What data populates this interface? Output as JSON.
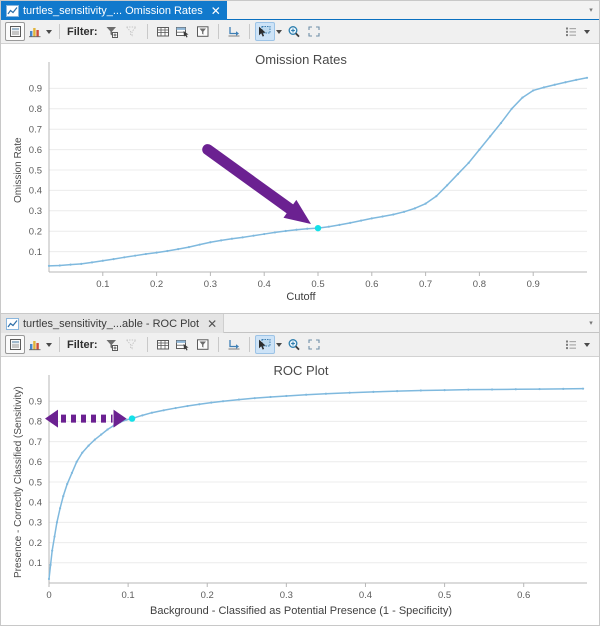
{
  "window": {
    "dropdown_glyph": "▾"
  },
  "panels": [
    {
      "tab": {
        "label": "turtles_sensitivity_... Omission Rates",
        "close": "✕",
        "icon": "chart-line-icon",
        "active": true
      },
      "toolbar": {
        "filter_label": "Filter:",
        "buttons": [
          {
            "name": "table-view-button",
            "icon": "table-view-icon"
          },
          {
            "name": "chart-view-button",
            "icon": "bar-chart-icon",
            "caret": true
          },
          {
            "name": "filter-build-button",
            "icon": "funnel-add-icon"
          },
          {
            "name": "filter-clear-button",
            "icon": "funnel-clear-icon",
            "dim": true
          },
          {
            "name": "show-all-records-button",
            "icon": "grid-icon"
          },
          {
            "name": "show-selected-records-button",
            "icon": "grid-selected-icon"
          },
          {
            "name": "show-extent-records-button",
            "icon": "funnel-extent-icon"
          },
          {
            "name": "switch-selection-button",
            "icon": "switch-selection-icon"
          },
          {
            "name": "select-tool-button",
            "icon": "select-arrow-icon",
            "caret": true,
            "selected": true
          },
          {
            "name": "zoom-tool-button",
            "icon": "magnifier-icon"
          },
          {
            "name": "full-extent-button",
            "icon": "full-extent-icon"
          }
        ],
        "legend_button": {
          "name": "legend-button",
          "icon": "list-legend-icon",
          "caret": true
        }
      },
      "chart_index": 0
    },
    {
      "tab": {
        "label": "turtles_sensitivity_...able - ROC Plot",
        "close": "✕",
        "icon": "chart-line-icon",
        "active": false
      },
      "toolbar": {
        "filter_label": "Filter:",
        "buttons": [
          {
            "name": "table-view-button",
            "icon": "table-view-icon"
          },
          {
            "name": "chart-view-button",
            "icon": "bar-chart-icon",
            "caret": true
          },
          {
            "name": "filter-build-button",
            "icon": "funnel-add-icon"
          },
          {
            "name": "filter-clear-button",
            "icon": "funnel-clear-icon",
            "dim": true
          },
          {
            "name": "show-all-records-button",
            "icon": "grid-icon"
          },
          {
            "name": "show-selected-records-button",
            "icon": "grid-selected-icon"
          },
          {
            "name": "show-extent-records-button",
            "icon": "funnel-extent-icon"
          },
          {
            "name": "switch-selection-button",
            "icon": "switch-selection-icon"
          },
          {
            "name": "select-tool-button",
            "icon": "select-arrow-icon",
            "caret": true,
            "selected": true
          },
          {
            "name": "zoom-tool-button",
            "icon": "magnifier-icon"
          },
          {
            "name": "full-extent-button",
            "icon": "full-extent-icon"
          }
        ],
        "legend_button": {
          "name": "legend-button",
          "icon": "list-legend-icon",
          "caret": true
        }
      },
      "chart_index": 1
    }
  ],
  "colors": {
    "series": "#7fb9de",
    "highlight": "#14e0e8",
    "annotation": "#6b2191",
    "grid": "#ececec",
    "axis": "#b7b7b7",
    "tab_active": "#1179cc",
    "toolbar": "#f0f0f0"
  },
  "chart_data": [
    {
      "type": "line",
      "title": "Omission Rates",
      "xlabel": "Cutoff",
      "ylabel": "Omission Rate",
      "xlim": [
        0.0,
        1.0
      ],
      "ylim": [
        0.0,
        1.0
      ],
      "xticks": [
        0.1,
        0.2,
        0.3,
        0.4,
        0.5,
        0.6,
        0.7,
        0.8,
        0.9
      ],
      "yticks": [
        0.1,
        0.2,
        0.3,
        0.4,
        0.5,
        0.6,
        0.7,
        0.8,
        0.9
      ],
      "grid": true,
      "legend": "none",
      "markers": true,
      "series": [
        {
          "name": "Omission Rate",
          "x": [
            0.0,
            0.02,
            0.04,
            0.06,
            0.08,
            0.1,
            0.12,
            0.14,
            0.16,
            0.18,
            0.2,
            0.22,
            0.24,
            0.26,
            0.28,
            0.3,
            0.32,
            0.34,
            0.36,
            0.38,
            0.4,
            0.42,
            0.44,
            0.46,
            0.48,
            0.5,
            0.52,
            0.54,
            0.56,
            0.58,
            0.6,
            0.62,
            0.64,
            0.66,
            0.68,
            0.7,
            0.72,
            0.74,
            0.76,
            0.78,
            0.8,
            0.82,
            0.84,
            0.86,
            0.88,
            0.9,
            0.92,
            0.94,
            0.96,
            0.98,
            1.0
          ],
          "y": [
            0.03,
            0.032,
            0.036,
            0.04,
            0.047,
            0.055,
            0.063,
            0.072,
            0.08,
            0.088,
            0.095,
            0.103,
            0.112,
            0.122,
            0.134,
            0.146,
            0.155,
            0.163,
            0.17,
            0.178,
            0.186,
            0.194,
            0.201,
            0.207,
            0.212,
            0.215,
            0.222,
            0.231,
            0.241,
            0.252,
            0.263,
            0.272,
            0.282,
            0.295,
            0.312,
            0.335,
            0.372,
            0.425,
            0.48,
            0.535,
            0.6,
            0.665,
            0.73,
            0.8,
            0.855,
            0.89,
            0.905,
            0.918,
            0.93,
            0.942,
            0.952
          ]
        }
      ],
      "highlight_point": {
        "x": 0.5,
        "y": 0.215,
        "label": "selected-cutoff-point"
      },
      "annotation": {
        "type": "arrow-diagonal",
        "name": "purple-arrow-annotation",
        "from": {
          "x": 0.295,
          "y": 0.6
        },
        "to": {
          "x": 0.487,
          "y": 0.235
        }
      }
    },
    {
      "type": "line",
      "title": "ROC Plot",
      "xlabel": "Background - Classified as Potential Presence (1 - Specificity)",
      "ylabel": "Presence - Correctly Classified (Sensitivity)",
      "xlim": [
        0.0,
        0.68
      ],
      "ylim": [
        0.0,
        1.0
      ],
      "xticks": [
        0,
        0.1,
        0.2,
        0.3,
        0.4,
        0.5,
        0.6
      ],
      "yticks": [
        0.1,
        0.2,
        0.3,
        0.4,
        0.5,
        0.6,
        0.7,
        0.8,
        0.9
      ],
      "grid": true,
      "legend": "none",
      "markers": true,
      "series": [
        {
          "name": "ROC Curve",
          "x": [
            0.0,
            0.002,
            0.004,
            0.007,
            0.01,
            0.014,
            0.018,
            0.023,
            0.029,
            0.035,
            0.042,
            0.05,
            0.058,
            0.066,
            0.074,
            0.082,
            0.09,
            0.098,
            0.105,
            0.118,
            0.13,
            0.145,
            0.16,
            0.175,
            0.19,
            0.205,
            0.22,
            0.24,
            0.26,
            0.28,
            0.3,
            0.325,
            0.35,
            0.38,
            0.41,
            0.44,
            0.47,
            0.5,
            0.53,
            0.56,
            0.59,
            0.62,
            0.65,
            0.675
          ],
          "y": [
            0.02,
            0.09,
            0.16,
            0.23,
            0.3,
            0.37,
            0.43,
            0.49,
            0.545,
            0.6,
            0.645,
            0.68,
            0.71,
            0.735,
            0.76,
            0.78,
            0.796,
            0.808,
            0.814,
            0.83,
            0.843,
            0.855,
            0.866,
            0.876,
            0.885,
            0.893,
            0.9,
            0.908,
            0.915,
            0.921,
            0.926,
            0.932,
            0.937,
            0.942,
            0.946,
            0.95,
            0.953,
            0.955,
            0.957,
            0.958,
            0.959,
            0.96,
            0.961,
            0.962
          ]
        }
      ],
      "highlight_point": {
        "x": 0.105,
        "y": 0.814,
        "label": "selected-threshold-point"
      },
      "annotation": {
        "type": "arrow-double-dashed",
        "name": "purple-double-arrow-annotation",
        "from": {
          "x": 0.0,
          "y": 0.814
        },
        "to": {
          "x": 0.098,
          "y": 0.814
        }
      }
    }
  ]
}
